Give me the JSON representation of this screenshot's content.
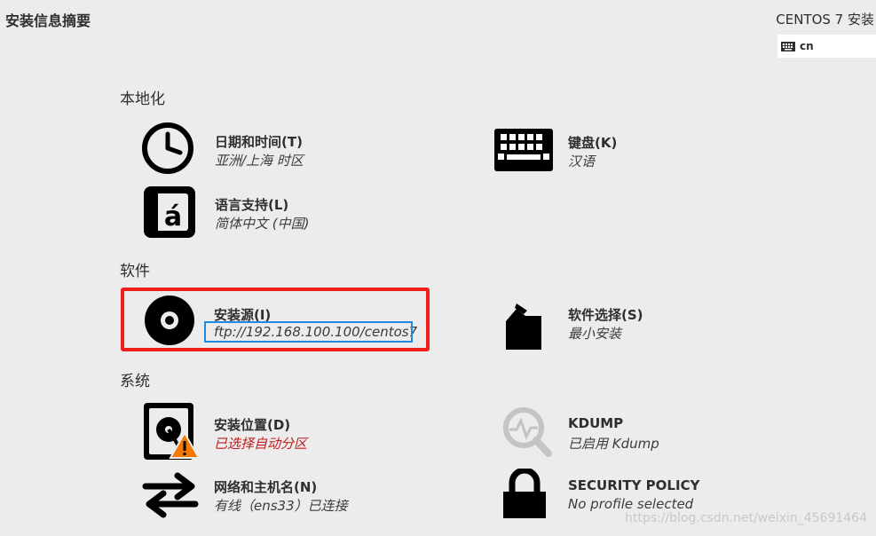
{
  "header": {
    "page_title": "安装信息摘要",
    "product_title": "CENTOS 7 安装",
    "keyboard_indicator": "cn"
  },
  "sections": {
    "localization": "本地化",
    "software": "软件",
    "system": "系统"
  },
  "spokes": {
    "datetime": {
      "title": "日期和时间(T)",
      "status": "亚洲/上海 时区",
      "icon": "clock-icon"
    },
    "keyboard": {
      "title": "键盘(K)",
      "status": "汉语",
      "icon": "keyboard-icon"
    },
    "language": {
      "title": "语言支持(L)",
      "status": "简体中文 (中国)",
      "icon": "language-icon"
    },
    "source": {
      "title": "安装源(I)",
      "status": "ftp://192.168.100.100/centos7",
      "icon": "disc-icon"
    },
    "software_selection": {
      "title": "软件选择(S)",
      "status": "最小安装",
      "icon": "package-icon"
    },
    "destination": {
      "title": "安装位置(D)",
      "status": "已选择自动分区",
      "icon": "harddisk-warning-icon"
    },
    "kdump": {
      "title": "KDUMP",
      "status": "已启用 Kdump",
      "icon": "magnifier-icon"
    },
    "network": {
      "title": "网络和主机名(N)",
      "status": "有线（ens33）已连接",
      "icon": "network-arrows-icon"
    },
    "security": {
      "title": "SECURITY POLICY",
      "status": "No profile selected",
      "icon": "lock-icon"
    }
  },
  "colors": {
    "background": "#ececec",
    "highlight_red": "#f21d1d",
    "highlight_blue": "#1e88e5",
    "warning_text": "#c01c1c",
    "warning_triangle": "#f57900"
  },
  "watermark": "https://blog.csdn.net/weixin_45691464"
}
